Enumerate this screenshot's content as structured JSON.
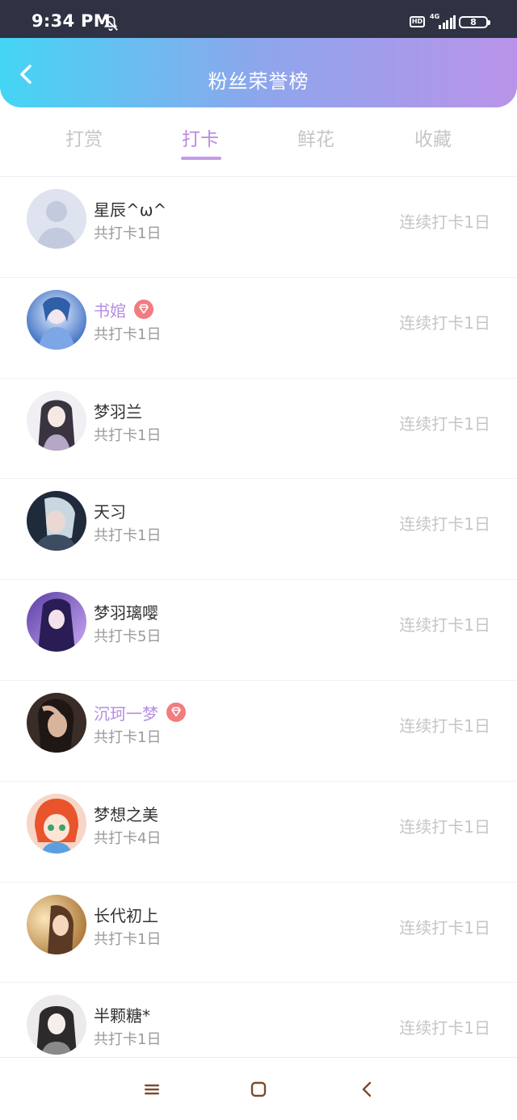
{
  "status_bar": {
    "time": "9:34 PM",
    "hd_label": "HD",
    "network_label": "4G",
    "battery": "8"
  },
  "header": {
    "title": "粉丝荣誉榜"
  },
  "tabs": [
    {
      "label": "打赏",
      "active": false
    },
    {
      "label": "打卡",
      "active": true
    },
    {
      "label": "鲜花",
      "active": false
    },
    {
      "label": "收藏",
      "active": false
    }
  ],
  "fans": [
    {
      "name": "星辰^ω^",
      "vip": false,
      "total": "共打卡1日",
      "streak": "连续打卡1日",
      "avatar": "default-avatar"
    },
    {
      "name": "书婠",
      "vip": true,
      "total": "共打卡1日",
      "streak": "连续打卡1日",
      "avatar": "anime-blue-avatar"
    },
    {
      "name": "梦羽兰",
      "vip": false,
      "total": "共打卡1日",
      "streak": "连续打卡1日",
      "avatar": "anime-purple-avatar"
    },
    {
      "name": "天习",
      "vip": false,
      "total": "共打卡1日",
      "streak": "连续打卡1日",
      "avatar": "anime-dark-avatar"
    },
    {
      "name": "梦羽璃嘤",
      "vip": false,
      "total": "共打卡5日",
      "streak": "连续打卡1日",
      "avatar": "anime-violet-avatar"
    },
    {
      "name": "沉珂一梦",
      "vip": true,
      "total": "共打卡1日",
      "streak": "连续打卡1日",
      "avatar": "photo-girl-avatar"
    },
    {
      "name": "梦想之美",
      "vip": false,
      "total": "共打卡4日",
      "streak": "连续打卡1日",
      "avatar": "cartoon-girl-avatar"
    },
    {
      "name": "长代初上",
      "vip": false,
      "total": "共打卡1日",
      "streak": "连续打卡1日",
      "avatar": "golden-portrait-avatar"
    },
    {
      "name": "半颗糖*",
      "vip": false,
      "total": "共打卡1日",
      "streak": "连续打卡1日",
      "avatar": "anime-sketch-avatar"
    }
  ],
  "colors": {
    "accent": "#bb8ae4",
    "header_start": "#44d5f4",
    "header_end": "#b993e9",
    "vip_badge": "#f27c80"
  }
}
